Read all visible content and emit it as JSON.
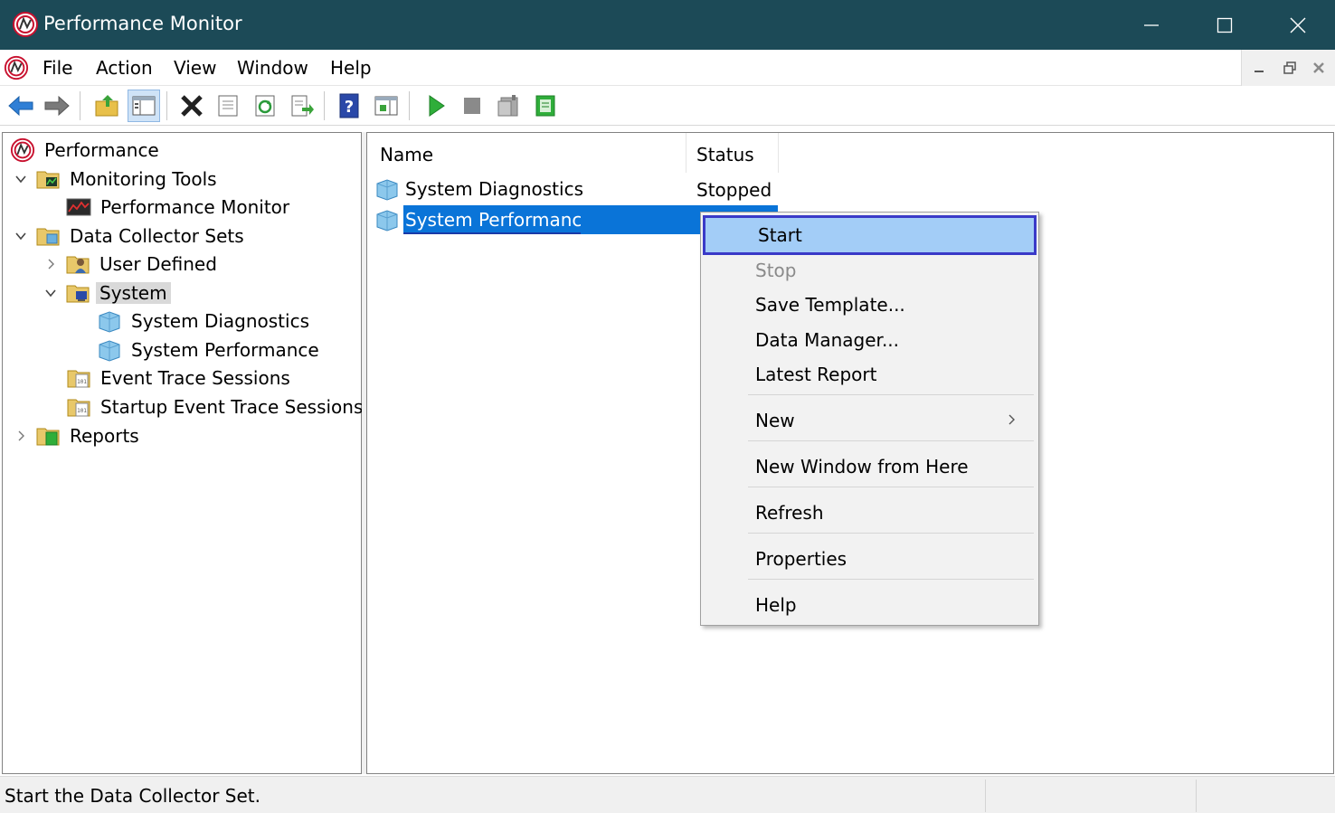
{
  "window": {
    "title": "Performance Monitor",
    "app_icon": "perfmon-icon",
    "controls": [
      "minimize-icon",
      "maximize-icon",
      "close-icon"
    ]
  },
  "menubar": {
    "items": [
      "File",
      "Action",
      "View",
      "Window",
      "Help"
    ]
  },
  "toolbar": {
    "buttons": [
      "back-arrow-icon",
      "forward-arrow-icon",
      "up-folder-icon",
      "show-hide-tree-icon",
      "delete-icon",
      "properties-icon",
      "refresh-icon",
      "export-list-icon",
      "help-icon",
      "show-hide-action-pane-icon",
      "start-icon",
      "stop-icon",
      "latest-report-icon",
      "new-data-collector-set-icon"
    ]
  },
  "tree": {
    "root": "Performance",
    "monitoring_tools": "Monitoring Tools",
    "performance_monitor": "Performance Monitor",
    "data_collector_sets": "Data Collector Sets",
    "user_defined": "User Defined",
    "system": "System",
    "system_diagnostics": "System Diagnostics",
    "system_performance": "System Performance",
    "event_trace_sessions": "Event Trace Sessions",
    "startup_event_trace_sessions": "Startup Event Trace Sessions",
    "reports": "Reports"
  },
  "list": {
    "columns": {
      "name": "Name",
      "status": "Status"
    },
    "rows": [
      {
        "name": "System Diagnostics",
        "status": "Stopped"
      },
      {
        "name": "System Performance",
        "status": ""
      }
    ]
  },
  "context_menu": {
    "start": "Start",
    "stop": "Stop",
    "save_template": "Save Template...",
    "data_manager": "Data Manager...",
    "latest_report": "Latest Report",
    "new": "New",
    "new_window": "New Window from Here",
    "refresh": "Refresh",
    "properties": "Properties",
    "help": "Help"
  },
  "statusbar": {
    "text": "Start the Data Collector Set."
  },
  "colors": {
    "titlebar": "#1c4a57",
    "selection": "#0a74d8",
    "menu_highlight": "#a3cdf7",
    "menu_highlight_border": "#3a3ac8"
  }
}
